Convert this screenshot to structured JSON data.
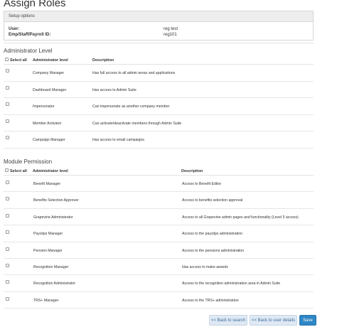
{
  "page_title": "Assign Roles",
  "setup": {
    "header": "Setup options",
    "user_label": "User:",
    "user_value": "reg test",
    "id_label": "Emp/Staff/Payroll ID:",
    "id_value": "reg101"
  },
  "admin": {
    "title": "Administrator Level",
    "select_all": "Select all",
    "col_level": "Administrator level",
    "col_desc": "Description",
    "rows": [
      {
        "level": "Company Manager",
        "desc": "Has full access to all admin areas and applications"
      },
      {
        "level": "Dashboard Manager",
        "desc": "Has access to Admin Suite"
      },
      {
        "level": "Impersonator",
        "desc": "Can impersonate as another company member"
      },
      {
        "level": "Member Activator",
        "desc": "Can activate/deactivate members through Admin Suite"
      },
      {
        "level": "Campaign Manager",
        "desc": "Has access to email campaigns"
      }
    ]
  },
  "module": {
    "title": "Module Permission",
    "select_all": "Select all",
    "col_level": "Administrator level",
    "col_desc": "Description",
    "rows": [
      {
        "level": "Benefit Manager",
        "desc": "Access to Benefit Editor"
      },
      {
        "level": "Benefits Selection Approver",
        "desc": "Access to benefits selection approval"
      },
      {
        "level": "Grapevine Administrator",
        "desc": "Access to all Grapevine admin pages and functionality (Level 5 access)"
      },
      {
        "level": "Payslips Manager",
        "desc": "Access to the payslips administration"
      },
      {
        "level": "Pension Manager",
        "desc": "Access to the pensions administration"
      },
      {
        "level": "Recognition Manager",
        "desc": "Has access to make awards"
      },
      {
        "level": "Recognition Administrator",
        "desc": "Access to the recognition administration area in Admin Suite"
      },
      {
        "level": "TRS+ Manager",
        "desc": "Access to the TRS+ administration"
      }
    ]
  },
  "buttons": {
    "back_search": "<< Back to search",
    "back_user": "<< Back to user details",
    "save": "Save"
  }
}
